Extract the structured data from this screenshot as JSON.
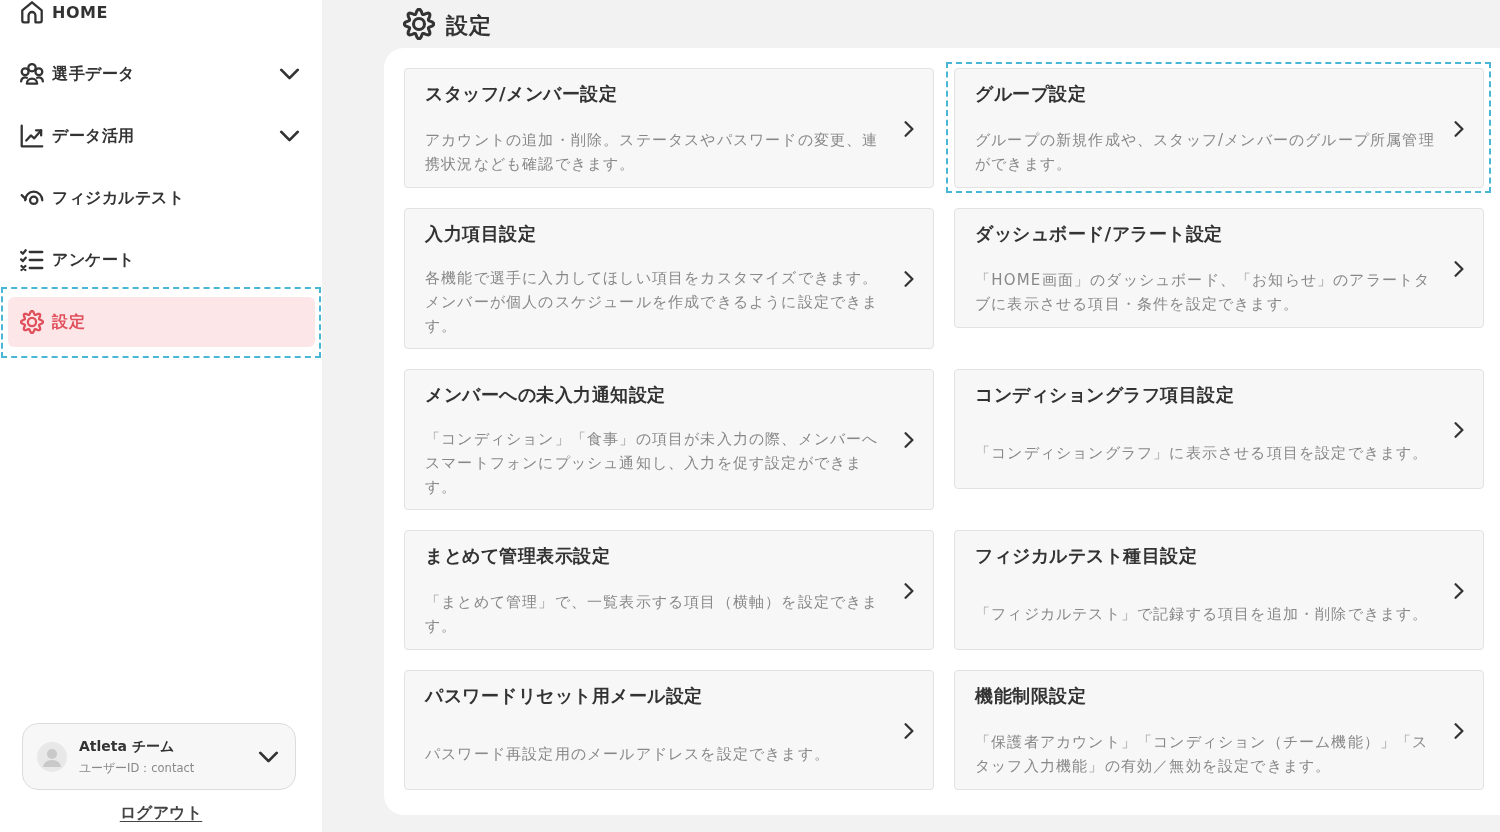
{
  "sidebar": {
    "items": [
      {
        "label": "HOME",
        "selected": false,
        "highlighted": false
      },
      {
        "label": "選手データ",
        "selected": false,
        "highlighted": false,
        "expanded": false
      },
      {
        "label": "データ活用",
        "selected": false,
        "highlighted": false,
        "expanded": false
      },
      {
        "label": "フィジカルテスト",
        "selected": false,
        "highlighted": false
      },
      {
        "label": "アンケート",
        "selected": false,
        "highlighted": false
      },
      {
        "label": "設定",
        "selected": true,
        "highlighted": true
      }
    ],
    "account": {
      "name": "Atleta チーム",
      "user_id": "ユーザーID：contact"
    },
    "logout": "ログアウト"
  },
  "page": {
    "title": "設定",
    "cards": [
      {
        "title": "スタッフ/メンバー設定",
        "description": "アカウントの追加・削除。ステータスやパスワードの変更、連携状況なども確認できます。",
        "highlighted": false
      },
      {
        "title": "グループ設定",
        "description": "グループの新規作成や、スタッフ/メンバーのグループ所属管理ができます。",
        "highlighted": true
      },
      {
        "title": "入力項目設定",
        "description": "各機能で選手に入力してほしい項目をカスタマイズできます。メンバーが個人のスケジュールを作成できるように設定できます。",
        "highlighted": false
      },
      {
        "title": "ダッシュボード/アラート設定",
        "description": "「HOME画面」のダッシュボード、「お知らせ」のアラートタブに表示させる項目・条件を設定できます。",
        "highlighted": false
      },
      {
        "title": "メンバーへの未入力通知設定",
        "description": "「コンディション」「食事」の項目が未入力の際、メンバーへスマートフォンにプッシュ通知し、入力を促す設定ができます。",
        "highlighted": false
      },
      {
        "title": "コンディショングラフ項目設定",
        "description": "「コンディショングラフ」に表示させる項目を設定できます。",
        "highlighted": false
      },
      {
        "title": "まとめて管理表示設定",
        "description": "「まとめて管理」で、一覧表示する項目（横軸）を設定できます。",
        "highlighted": false
      },
      {
        "title": "フィジカルテスト種目設定",
        "description": "「フィジカルテスト」で記録する項目を追加・削除できます。",
        "highlighted": false
      },
      {
        "title": "パスワードリセット用メール設定",
        "description": "パスワード再設定用のメールアドレスを設定できます。",
        "highlighted": false
      },
      {
        "title": "機能制限設定",
        "description": "「保護者アカウント」「コンディション（チーム機能）」「スタッフ入力機能」の有効／無効を設定できます。",
        "highlighted": false
      }
    ]
  }
}
